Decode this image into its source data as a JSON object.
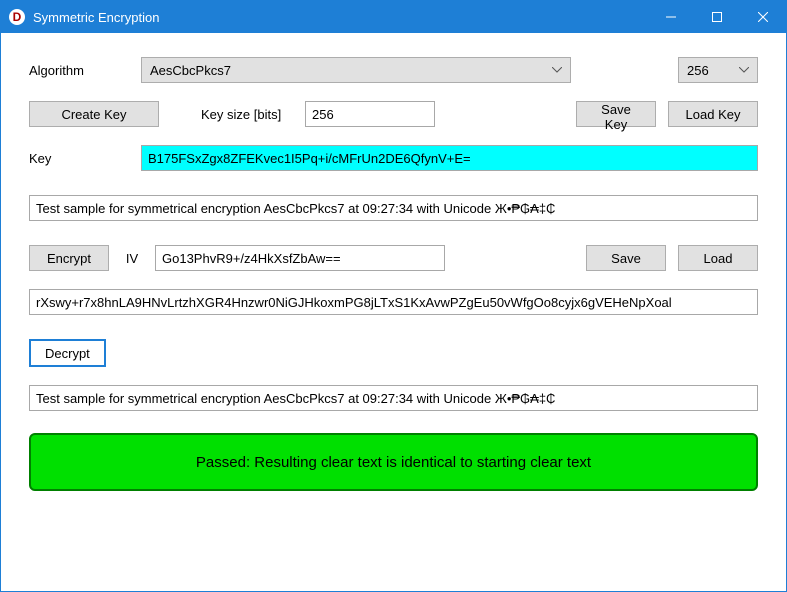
{
  "titlebar": {
    "title": "Symmetric Encryption"
  },
  "algorithm": {
    "label": "Algorithm",
    "selected": "AesCbcPkcs7",
    "bits_selected": "256"
  },
  "key_row": {
    "create_key": "Create Key",
    "key_size_label": "Key size [bits]",
    "key_size_value": "256",
    "save_key": "Save Key",
    "load_key": "Load Key"
  },
  "key": {
    "label": "Key",
    "value": "B175FSxZgx8ZFEKvec1I5Pq+i/cMFrUn2DE6QfynV+E="
  },
  "plaintext": {
    "value": "Test sample for symmetrical encryption AesCbcPkcs7 at 09:27:34 with Unicode Ж•₱₲₳‡₵"
  },
  "encrypt_row": {
    "encrypt": "Encrypt",
    "iv_label": "IV",
    "iv_value": "Go13PhvR9+/z4HkXsfZbAw==",
    "save": "Save",
    "load": "Load"
  },
  "ciphertext": {
    "value": "rXswy+r7x8hnLA9HNvLrtzhXGR4Hnzwr0NiGJHkoxmPG8jLTxS1KxAvwPZgEu50vWfgOo8cyjx6gVEHeNpXoal"
  },
  "decrypt": {
    "label": "Decrypt"
  },
  "decrypted": {
    "value": "Test sample for symmetrical encryption AesCbcPkcs7 at 09:27:34 with Unicode Ж•₱₲₳‡₵"
  },
  "status": {
    "text": "Passed: Resulting clear text is identical to starting clear text"
  }
}
